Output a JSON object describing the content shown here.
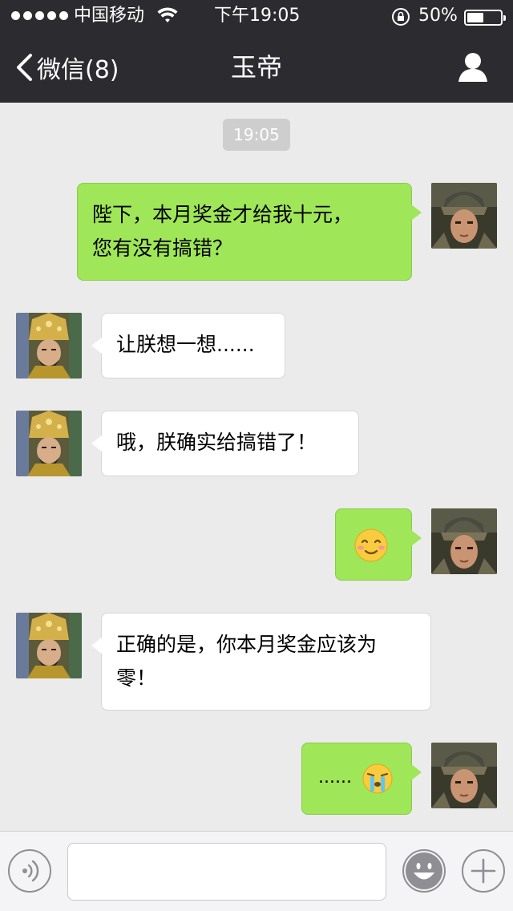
{
  "status_bar": {
    "carrier": "中国移动",
    "time": "下午19:05",
    "battery": "50%"
  },
  "nav": {
    "back_label": "微信(8)",
    "title": "玉帝"
  },
  "chat": {
    "timestamp": "19:05",
    "messages": [
      {
        "side": "out",
        "text_line1": "陛下，本月奖金才给我十元，",
        "text_line2": "您有没有搞错？"
      },
      {
        "side": "in",
        "text": "让朕想一想......"
      },
      {
        "side": "in",
        "text": "哦，朕确实给搞错了！"
      },
      {
        "side": "out",
        "emoji": "smile-emoji"
      },
      {
        "side": "in",
        "text_line1": "正确的是，你本月奖金应该为",
        "text_line2": "零！"
      },
      {
        "side": "out",
        "text": "......",
        "emoji": "crying-emoji"
      }
    ]
  },
  "input": {
    "placeholder": ""
  },
  "icons": [
    "back-arrow-icon",
    "profile-icon",
    "voice-icon",
    "emoji-icon",
    "plus-icon",
    "wifi-icon",
    "rotation-lock-icon",
    "battery-icon"
  ]
}
